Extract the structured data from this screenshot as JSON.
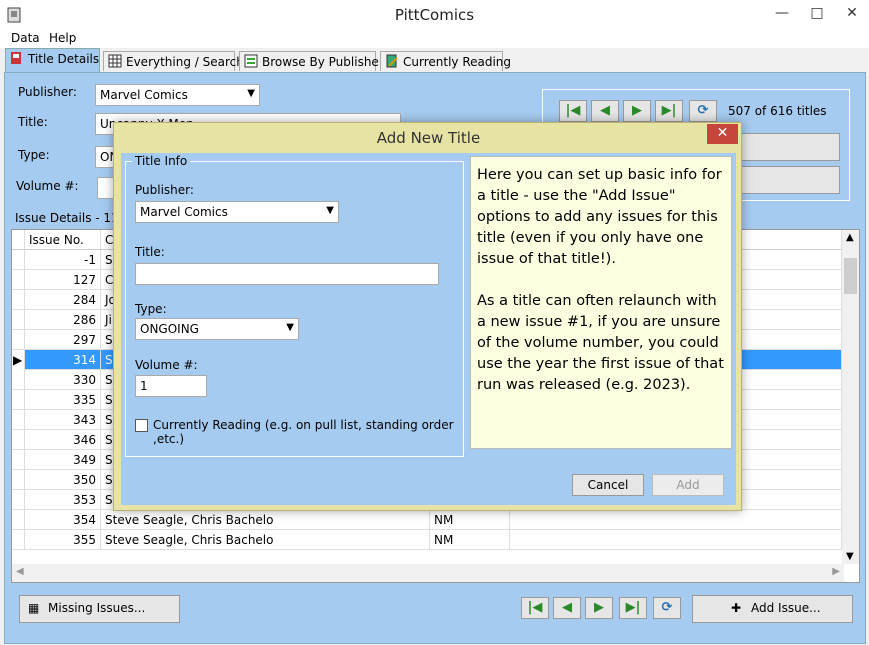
{
  "window": {
    "title": "PittComics"
  },
  "menu": [
    "Data",
    "Help"
  ],
  "tabs": [
    {
      "label": "Title Details",
      "active": true
    },
    {
      "label": "Everything / Search"
    },
    {
      "label": "Browse By Publisher"
    },
    {
      "label": "Currently Reading"
    }
  ],
  "title_details": {
    "publisher_label": "Publisher:",
    "publisher_value": "Marvel Comics",
    "title_label": "Title:",
    "title_value": "Uncanny X-Men",
    "type_label": "Type:",
    "type_value": "ON",
    "volume_label": "Volume #:",
    "count_text": "507 of 616 titles",
    "right_btn1": "...",
    "right_btn2": "..."
  },
  "issues": {
    "group_label": "Issue Details - 111",
    "columns": [
      "Issue No.",
      "Cr",
      "",
      ""
    ],
    "rows": [
      {
        "no": "-1",
        "creators": "Sc",
        "grade": ""
      },
      {
        "no": "127",
        "creators": "Ch",
        "grade": ""
      },
      {
        "no": "284",
        "creators": "Jo",
        "grade": ""
      },
      {
        "no": "286",
        "creators": "Jin",
        "grade": ""
      },
      {
        "no": "297",
        "creators": "Sc",
        "grade": ""
      },
      {
        "no": "314",
        "creators": "Sc",
        "grade": "",
        "selected": true
      },
      {
        "no": "330",
        "creators": "Sc",
        "grade": ""
      },
      {
        "no": "335",
        "creators": "Sc",
        "grade": ""
      },
      {
        "no": "343",
        "creators": "Sc",
        "grade": ""
      },
      {
        "no": "346",
        "creators": "Sc",
        "grade": ""
      },
      {
        "no": "349",
        "creators": "Sc",
        "grade": ""
      },
      {
        "no": "350",
        "creators": "Ste",
        "grade": ""
      },
      {
        "no": "353",
        "creators": "Ste",
        "grade": ""
      },
      {
        "no": "354",
        "creators": "Steve Seagle, Chris Bachelo",
        "grade": "NM"
      },
      {
        "no": "355",
        "creators": "Steve Seagle, Chris Bachelo",
        "grade": "NM"
      }
    ],
    "missing_btn": "Missing Issues...",
    "add_issue_btn": "Add Issue..."
  },
  "dialog": {
    "title": "Add New Title",
    "group_label": "Title Info",
    "publisher_label": "Publisher:",
    "publisher_value": "Marvel Comics",
    "title_label": "Title:",
    "title_value": "",
    "type_label": "Type:",
    "type_value": "ONGOING",
    "volume_label": "Volume #:",
    "volume_value": "1",
    "reading_label": "Currently Reading (e.g. on pull list, standing order ,etc.)",
    "help_p1": "Here you can set up basic info for a title - use the \"Add Issue\" options to add any issues for this title (even if you only have one issue of that title!).",
    "help_p2": "As a title can often relaunch with a new issue #1, if you are unsure of the volume number, you could use the year the first issue of that run was released (e.g. 2023).",
    "cancel": "Cancel",
    "add": "Add"
  }
}
